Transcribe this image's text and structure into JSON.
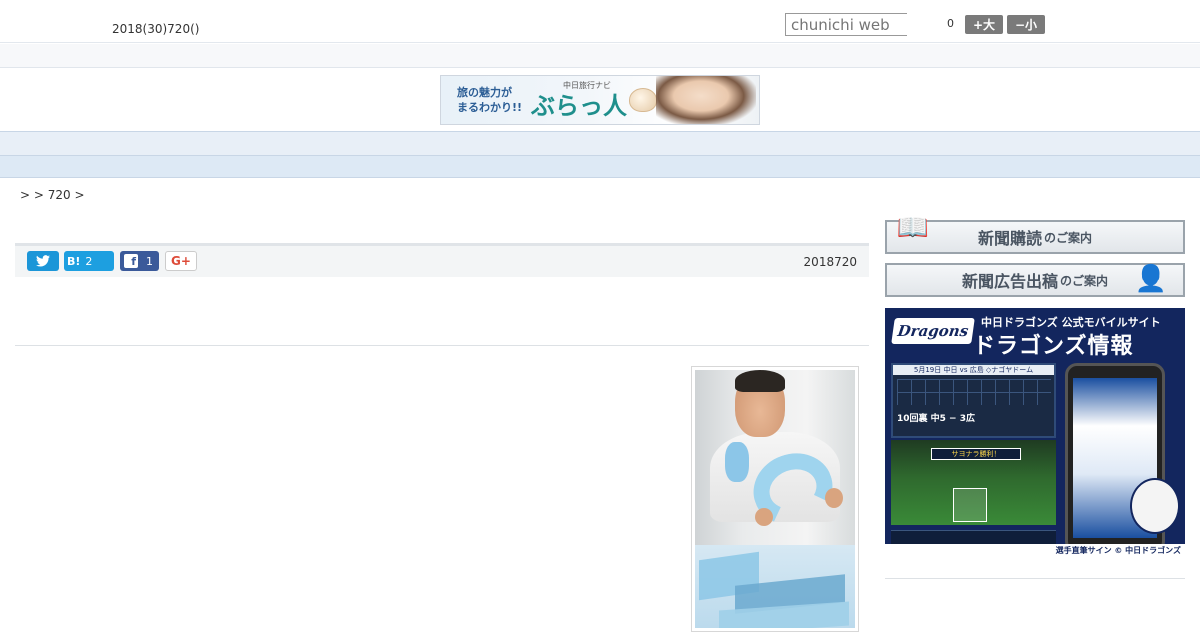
{
  "topbar": {
    "date": "2018(30)720()",
    "search_placeholder": "chunichi web",
    "fontsize_value": "0",
    "fontsize_plus": "+大",
    "fontsize_minus": "−小"
  },
  "banner": {
    "catch": "旅の魅力が\nまるわかり!!",
    "sub": "中日旅行ナビ",
    "logo": "ぶらっ人"
  },
  "nav": {
    "items": [
      "",
      "",
      "",
      "",
      "",
      "",
      "",
      "",
      ""
    ]
  },
  "breadcrumb": ">  > 720 >",
  "article": {
    "hatena_label": "B!",
    "hatena_count": "2",
    "facebook_count": "1",
    "gplus_label": "G+",
    "date": "2018720"
  },
  "sidebar": {
    "subscribe_main": "新聞購読",
    "subscribe_small": "のご案内",
    "ad_main": "新聞広告出稿",
    "ad_small": "のご案内",
    "dragons": {
      "logo": "Dragons",
      "head1": "中日ドラゴンズ 公式モバイルサイト",
      "head2": "ドラゴンズ情報",
      "board_header": "5月19日 中日 vs 広島 ◇ナゴヤドーム",
      "score": "10回裏 中5 − 3広",
      "banner": "サヨナラ勝利！",
      "footer": "選手直筆サイン © 中日ドラゴンズ"
    }
  }
}
